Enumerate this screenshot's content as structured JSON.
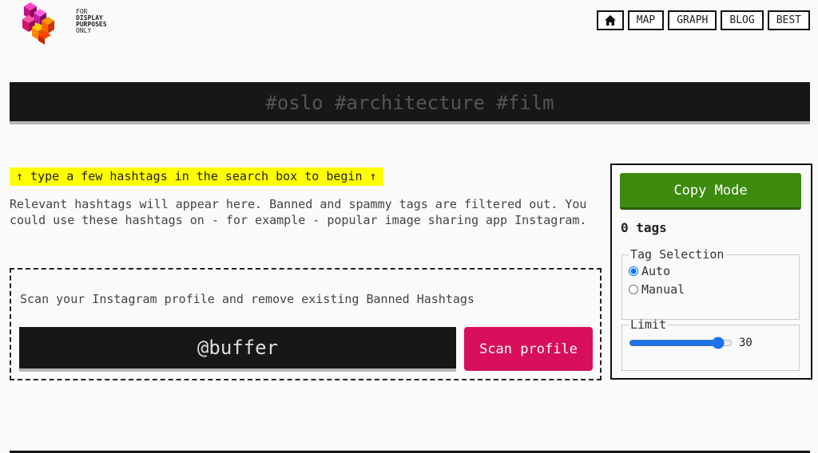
{
  "logo": {
    "line1": "FOR",
    "line2": "DISPLAY",
    "line3": "PURPOSES",
    "line4": "ONLY"
  },
  "nav": {
    "home_icon": "home-icon",
    "items": [
      "MAP",
      "GRAPH",
      "BLOG",
      "BEST"
    ]
  },
  "search": {
    "placeholder": "#oslo #architecture #film"
  },
  "hint": "↑ type a few hashtags in the search box to begin ↑",
  "description": "Relevant hashtags will appear here. Banned and spammy tags are filtered out. You could use these hashtags on - for example - popular image sharing app Instagram.",
  "scan": {
    "label": "Scan your Instagram profile and remove existing Banned Hashtags",
    "value": "@buffer",
    "button": "Scan profile"
  },
  "panel": {
    "copy_button": "Copy Mode",
    "tag_count": "0 tags",
    "tag_selection": {
      "legend": "Tag Selection",
      "options": [
        "Auto",
        "Manual"
      ],
      "selected": "Auto"
    },
    "limit": {
      "legend": "Limit",
      "value": "30"
    }
  },
  "colors": {
    "accent_scan": "#d70f5a",
    "accent_copy": "#3d8b0f",
    "hint_bg": "#ffff00",
    "bar_bg": "#171717"
  }
}
